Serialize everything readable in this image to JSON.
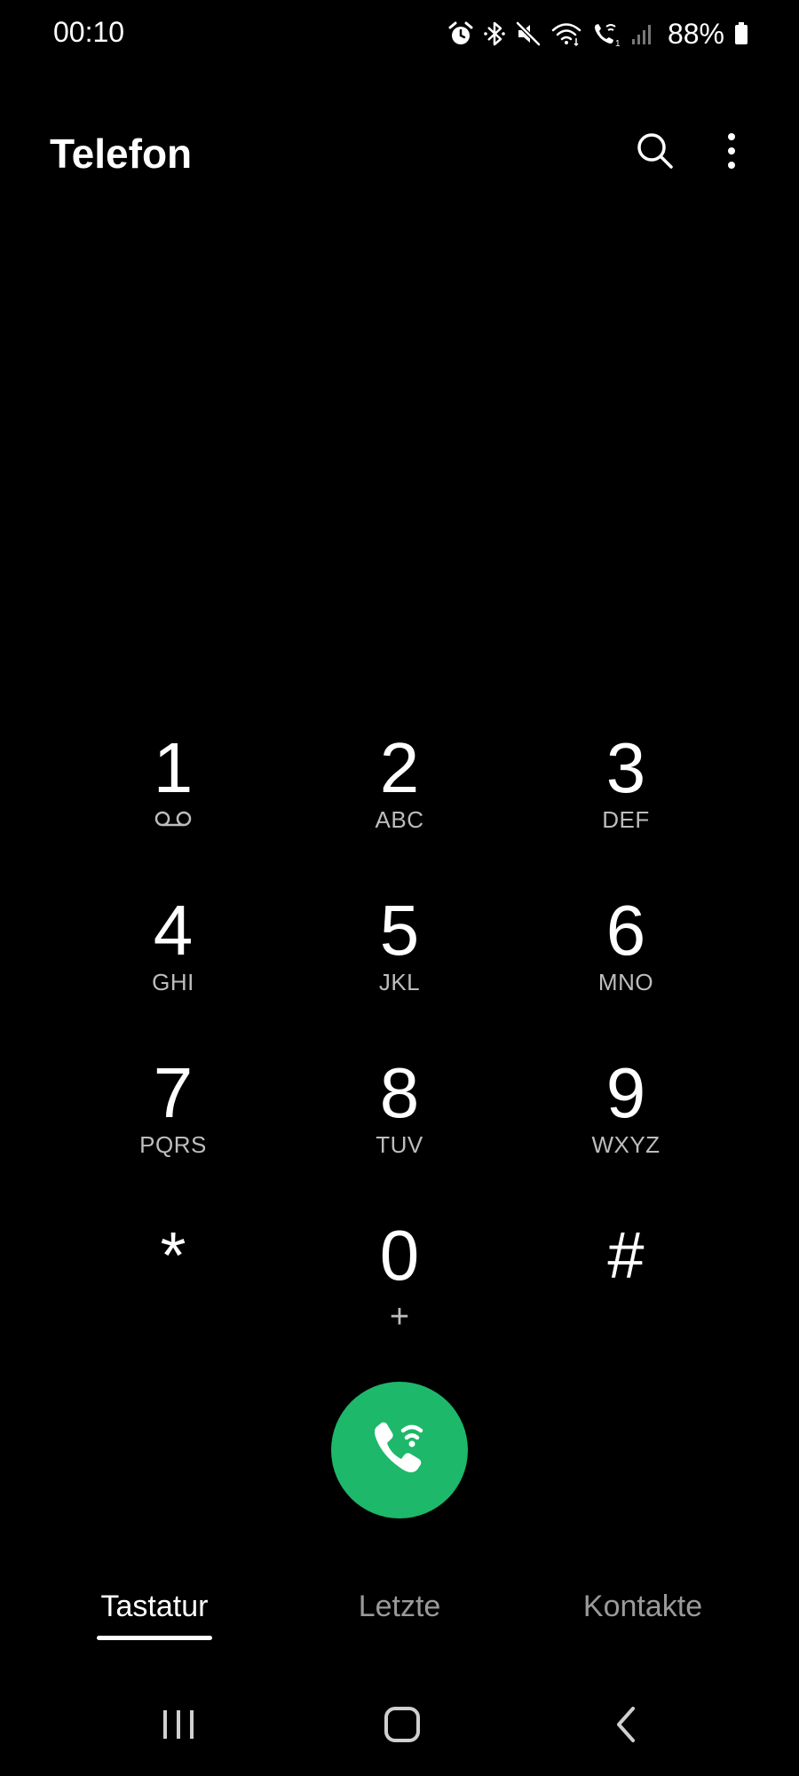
{
  "status_bar": {
    "time": "00:10",
    "battery_percent": "88%",
    "icons": [
      "alarm-icon",
      "bluetooth-icon",
      "mute-icon",
      "wifi-icon",
      "wifi-calling-icon",
      "signal-icon",
      "battery-icon"
    ]
  },
  "header": {
    "title": "Telefon",
    "actions": [
      "search-icon",
      "more-options-icon"
    ]
  },
  "keypad": {
    "keys": [
      {
        "digit": "1",
        "letters": "",
        "sub_icon": "voicemail-icon"
      },
      {
        "digit": "2",
        "letters": "ABC"
      },
      {
        "digit": "3",
        "letters": "DEF"
      },
      {
        "digit": "4",
        "letters": "GHI"
      },
      {
        "digit": "5",
        "letters": "JKL"
      },
      {
        "digit": "6",
        "letters": "MNO"
      },
      {
        "digit": "7",
        "letters": "PQRS"
      },
      {
        "digit": "8",
        "letters": "TUV"
      },
      {
        "digit": "9",
        "letters": "WXYZ"
      },
      {
        "digit": "*",
        "letters": ""
      },
      {
        "digit": "0",
        "letters": "+"
      },
      {
        "digit": "#",
        "letters": ""
      }
    ]
  },
  "call_button": {
    "icon": "wifi-call-icon",
    "color": "#1db86a"
  },
  "tabs": {
    "items": [
      {
        "label": "Tastatur",
        "active": true
      },
      {
        "label": "Letzte",
        "active": false
      },
      {
        "label": "Kontakte",
        "active": false
      }
    ]
  },
  "nav_bar": {
    "buttons": [
      "recents-icon",
      "home-icon",
      "back-icon"
    ]
  }
}
